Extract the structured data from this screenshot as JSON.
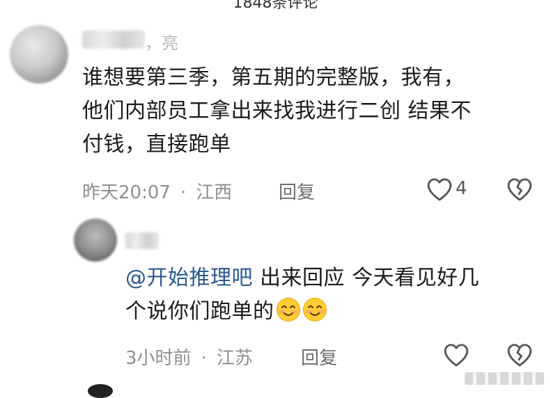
{
  "header": {
    "partial_title": "1848条评论"
  },
  "comment": {
    "name_suffix": "，亮",
    "text_lines": [
      "谁想要第三季，第五期的完整版，我有，",
      "他们内部员工拿出来找我进行二创 结果不",
      "付钱，直接跑单"
    ],
    "time": "昨天20:07",
    "location": "江西",
    "reply_label": "回复",
    "like_count": "4",
    "like_icon": "heart-outline-icon",
    "dislike_icon": "broken-heart-icon"
  },
  "reply": {
    "mention": "@开始推理吧",
    "text_line1": " 出来回应 今天看见好几",
    "text_line2": "个说你们跑单的",
    "emojis": [
      "smile-emoji",
      "smile-emoji"
    ],
    "time": "3小时前",
    "location": "江苏",
    "reply_label": "回复",
    "like_icon": "heart-outline-icon",
    "dislike_icon": "broken-heart-icon"
  },
  "colors": {
    "mention": "#2b5a93",
    "meta": "#8f8f8f",
    "icon": "#555555"
  }
}
